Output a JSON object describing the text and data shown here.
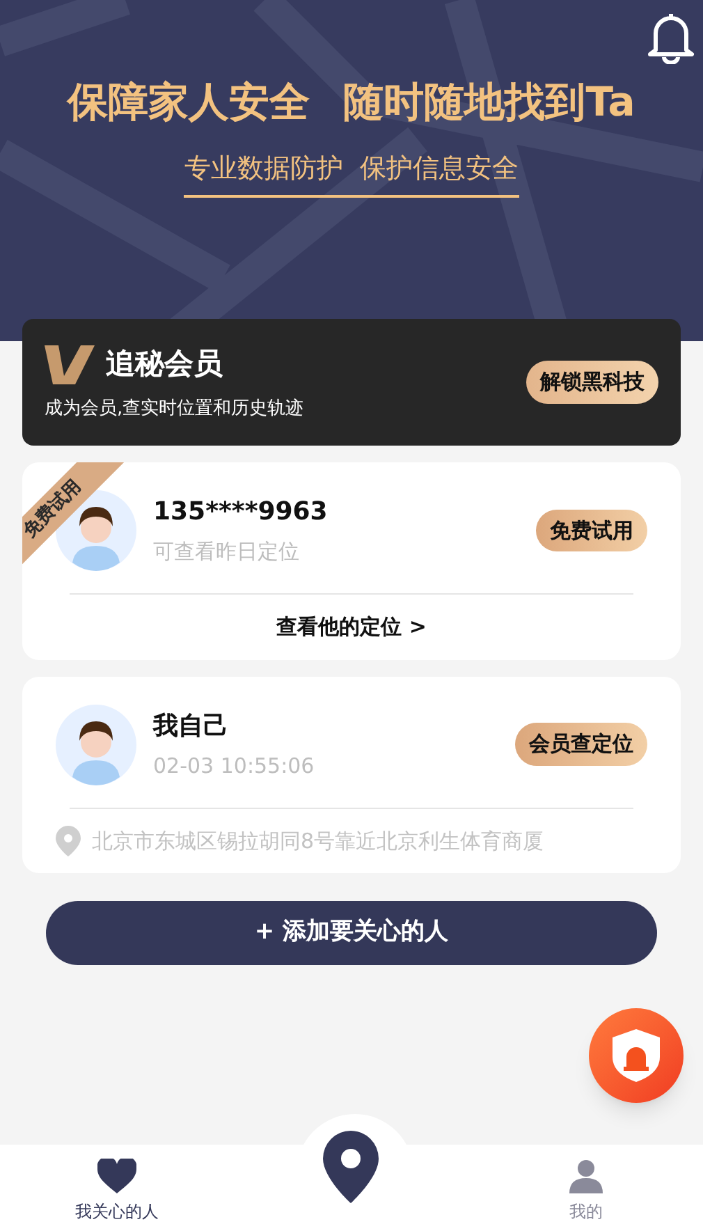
{
  "header": {
    "headline": [
      "保障家人安全",
      "随时随地找到Ta"
    ],
    "subtitle": "专业数据防护  保护信息安全"
  },
  "membership": {
    "title": "追秘会员",
    "description": "成为会员,查实时位置和历史轨迹",
    "button": "解锁黑科技"
  },
  "contacts": [
    {
      "kind": "trial",
      "ribbon": "免费试用",
      "name": "135****9963",
      "detail": "可查看昨日定位",
      "button": "免费试用",
      "footer": "查看他的定位 >"
    },
    {
      "kind": "self",
      "name": "我自己",
      "detail": "02-03 10:55:06",
      "button": "会员查定位",
      "footer": "北京市东城区锡拉胡同8号靠近北京利生体育商厦"
    }
  ],
  "add_button": "+ 添加要关心的人",
  "bottom_nav": [
    {
      "kind": "heart",
      "label": "我关心的人",
      "selected": true
    },
    {
      "kind": "person",
      "label": "我的",
      "selected": false
    }
  ]
}
